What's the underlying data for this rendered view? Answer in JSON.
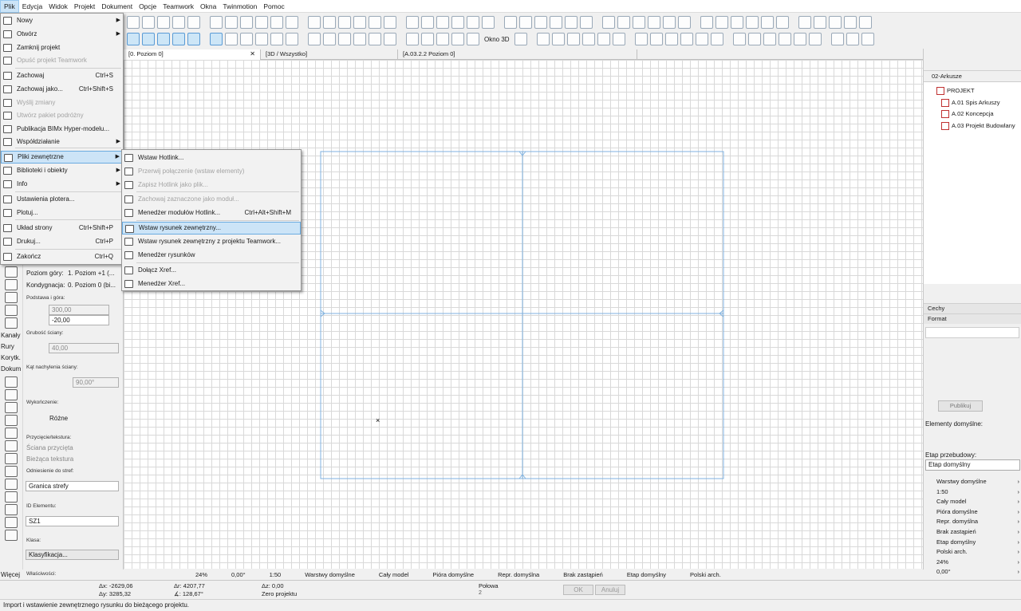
{
  "menubar": {
    "items": [
      "Plik",
      "Edycja",
      "Widok",
      "Projekt",
      "Dokument",
      "Opcje",
      "Teamwork",
      "Okna",
      "Twinmotion",
      "Pomoc"
    ]
  },
  "file_menu": {
    "items": [
      {
        "label": "Nowy",
        "shortcut": "",
        "submenu": true,
        "disabled": false
      },
      {
        "label": "Otwórz",
        "shortcut": "",
        "submenu": true,
        "disabled": false
      },
      {
        "label": "Zamknij projekt",
        "shortcut": "",
        "submenu": false,
        "disabled": false
      },
      {
        "label": "Opuść projekt Teamwork",
        "shortcut": "",
        "submenu": false,
        "disabled": true
      },
      {
        "label": "Zachowaj",
        "shortcut": "Ctrl+S",
        "submenu": false,
        "disabled": false
      },
      {
        "label": "Zachowaj jako...",
        "shortcut": "Ctrl+Shift+S",
        "submenu": false,
        "disabled": false
      },
      {
        "label": "Wyślij zmiany",
        "shortcut": "",
        "submenu": false,
        "disabled": true
      },
      {
        "label": "Utwórz pakiet podróżny",
        "shortcut": "",
        "submenu": false,
        "disabled": true
      },
      {
        "label": "Publikacja BIMx Hyper-modelu...",
        "shortcut": "",
        "submenu": false,
        "disabled": false
      },
      {
        "label": "Współdziałanie",
        "shortcut": "",
        "submenu": true,
        "disabled": false
      },
      {
        "label": "Pliki zewnętrzne",
        "shortcut": "",
        "submenu": true,
        "disabled": false
      },
      {
        "label": "Biblioteki i obiekty",
        "shortcut": "",
        "submenu": true,
        "disabled": false
      },
      {
        "label": "Info",
        "shortcut": "",
        "submenu": true,
        "disabled": false
      },
      {
        "label": "Ustawienia plotera...",
        "shortcut": "",
        "submenu": false,
        "disabled": false
      },
      {
        "label": "Plotuj...",
        "shortcut": "",
        "submenu": false,
        "disabled": false
      },
      {
        "label": "Układ strony",
        "shortcut": "Ctrl+Shift+P",
        "submenu": false,
        "disabled": false
      },
      {
        "label": "Drukuj...",
        "shortcut": "Ctrl+P",
        "submenu": false,
        "disabled": false
      },
      {
        "label": "Zakończ",
        "shortcut": "Ctrl+Q",
        "submenu": false,
        "disabled": false
      }
    ]
  },
  "sub_menu": {
    "items": [
      {
        "label": "Wstaw Hotlink...",
        "shortcut": "",
        "disabled": false
      },
      {
        "label": "Przerwij połączenie (wstaw elementy)",
        "shortcut": "",
        "disabled": true
      },
      {
        "label": "Zapisz Hotlink jako plik...",
        "shortcut": "",
        "disabled": true
      },
      {
        "label": "Zachowaj zaznaczone jako moduł...",
        "shortcut": "",
        "disabled": true
      },
      {
        "label": "Menedżer modułów Hotlink...",
        "shortcut": "Ctrl+Alt+Shift+M",
        "disabled": false
      },
      {
        "label": "Wstaw rysunek zewnętrzny...",
        "shortcut": "",
        "disabled": false
      },
      {
        "label": "Wstaw rysunek zewnętrzny z projektu Teamwork...",
        "shortcut": "",
        "disabled": false
      },
      {
        "label": "Menedżer rysunków",
        "shortcut": "",
        "disabled": false
      },
      {
        "label": "Dołącz Xref...",
        "shortcut": "",
        "disabled": false
      },
      {
        "label": "Menedżer Xref...",
        "shortcut": "",
        "disabled": false
      }
    ]
  },
  "toolbar": {
    "okno3d": "Okno 3D"
  },
  "tabs": [
    {
      "label": "[0. Poziom 0]"
    },
    {
      "label": "[3D / Wszystko]"
    },
    {
      "label": "[A.03.2.2 Poziom 0]"
    }
  ],
  "left_tools": {
    "labels": [
      "Kanały",
      "Rury",
      "Korytk.",
      "Dokum",
      "Więcej"
    ]
  },
  "info_panel": {
    "poziom_gory_label": "Poziom góry:",
    "poziom_gory_value": "1. Poziom +1 (...",
    "kondygnacja_label": "Kondygnacja:",
    "kondygnacja_value": "0. Poziom 0 (bi...",
    "podstawa_label": "Podstawa i góra:",
    "podstawa_top": "300,00",
    "podstawa_bottom": "-20,00",
    "grubosc_label": "Grubość ściany:",
    "grubosc_value": "40,00",
    "kat_label": "Kąt nachylenia ściany:",
    "kat_value": "90,00°",
    "wykonczenie_label": "Wykończenie:",
    "wykonczenie_value": "Różne",
    "przyciecie_label": "Przycięcie/tekstura:",
    "sciana_przycieta": "Ściana przycięta",
    "biezaca_tekstura": "Bieżąca tekstura",
    "odniesienie_label": "Odniesienie do stref:",
    "odniesienie_value": "Granica strefy",
    "id_label": "ID Elementu:",
    "id_value": "SZ1",
    "klasa_label": "Klasa:",
    "klasa_value": "Klasyfikacja...",
    "wlasciwosci_label": "Właściwości:"
  },
  "navigator": {
    "combo": "02-Arkusze",
    "root": "PROJEKT",
    "items": [
      "A.01 Spis Arkuszy",
      "A.02 Koncepcja",
      "A.03 Projekt Budowlany"
    ]
  },
  "properties": {
    "cechy": "Cechy",
    "format": "Format",
    "publikuj": "Publikuj",
    "elementy_label": "Elementy domyślne:",
    "etap_label": "Etap przebudowy:",
    "etap_value": "Etap domyślny",
    "list": [
      "Warstwy domyślne",
      "1:50",
      "Cały model",
      "Pióra domyślne",
      "Repr. domyślna",
      "Brak zastąpień",
      "Etap domyślny",
      "Polski arch.",
      "24%",
      "0,00°"
    ]
  },
  "zoombar": {
    "zoom": "24%",
    "angle": "0,00°",
    "scale": "1:50",
    "layers": "Warstwy domyślne",
    "model": "Cały model",
    "pens": "Pióra domyślne",
    "repr": "Repr. domyślna",
    "override": "Brak zastąpień",
    "phase": "Etap domyślny",
    "standard": "Polski arch."
  },
  "coords": {
    "dx": "Δx: -2629,06",
    "dy": "Δy: 3285,32",
    "dr": "Δr: 4207,77",
    "da": "∡: 128,67°",
    "dz": "Δz: 0,00",
    "zero": "Zero projektu",
    "polowa": "Połowa",
    "polowa_n": "2",
    "ok": "OK",
    "anuluj": "Anuluj"
  },
  "status": {
    "message": "Import i wstawienie zewnętrznego rysunku do bieżącego projektu."
  }
}
